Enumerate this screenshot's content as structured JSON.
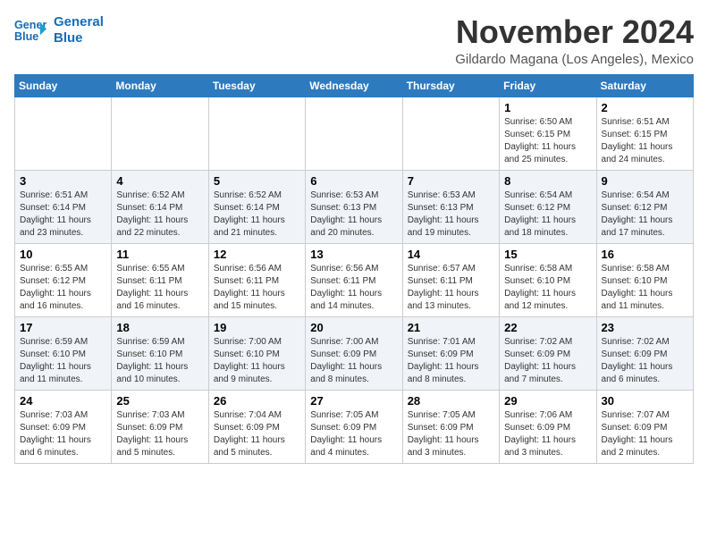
{
  "header": {
    "logo_line1": "General",
    "logo_line2": "Blue",
    "month_title": "November 2024",
    "subtitle": "Gildardo Magana (Los Angeles), Mexico"
  },
  "days_of_week": [
    "Sunday",
    "Monday",
    "Tuesday",
    "Wednesday",
    "Thursday",
    "Friday",
    "Saturday"
  ],
  "weeks": [
    [
      {
        "day": "",
        "info": ""
      },
      {
        "day": "",
        "info": ""
      },
      {
        "day": "",
        "info": ""
      },
      {
        "day": "",
        "info": ""
      },
      {
        "day": "",
        "info": ""
      },
      {
        "day": "1",
        "info": "Sunrise: 6:50 AM\nSunset: 6:15 PM\nDaylight: 11 hours\nand 25 minutes."
      },
      {
        "day": "2",
        "info": "Sunrise: 6:51 AM\nSunset: 6:15 PM\nDaylight: 11 hours\nand 24 minutes."
      }
    ],
    [
      {
        "day": "3",
        "info": "Sunrise: 6:51 AM\nSunset: 6:14 PM\nDaylight: 11 hours\nand 23 minutes."
      },
      {
        "day": "4",
        "info": "Sunrise: 6:52 AM\nSunset: 6:14 PM\nDaylight: 11 hours\nand 22 minutes."
      },
      {
        "day": "5",
        "info": "Sunrise: 6:52 AM\nSunset: 6:14 PM\nDaylight: 11 hours\nand 21 minutes."
      },
      {
        "day": "6",
        "info": "Sunrise: 6:53 AM\nSunset: 6:13 PM\nDaylight: 11 hours\nand 20 minutes."
      },
      {
        "day": "7",
        "info": "Sunrise: 6:53 AM\nSunset: 6:13 PM\nDaylight: 11 hours\nand 19 minutes."
      },
      {
        "day": "8",
        "info": "Sunrise: 6:54 AM\nSunset: 6:12 PM\nDaylight: 11 hours\nand 18 minutes."
      },
      {
        "day": "9",
        "info": "Sunrise: 6:54 AM\nSunset: 6:12 PM\nDaylight: 11 hours\nand 17 minutes."
      }
    ],
    [
      {
        "day": "10",
        "info": "Sunrise: 6:55 AM\nSunset: 6:12 PM\nDaylight: 11 hours\nand 16 minutes."
      },
      {
        "day": "11",
        "info": "Sunrise: 6:55 AM\nSunset: 6:11 PM\nDaylight: 11 hours\nand 16 minutes."
      },
      {
        "day": "12",
        "info": "Sunrise: 6:56 AM\nSunset: 6:11 PM\nDaylight: 11 hours\nand 15 minutes."
      },
      {
        "day": "13",
        "info": "Sunrise: 6:56 AM\nSunset: 6:11 PM\nDaylight: 11 hours\nand 14 minutes."
      },
      {
        "day": "14",
        "info": "Sunrise: 6:57 AM\nSunset: 6:11 PM\nDaylight: 11 hours\nand 13 minutes."
      },
      {
        "day": "15",
        "info": "Sunrise: 6:58 AM\nSunset: 6:10 PM\nDaylight: 11 hours\nand 12 minutes."
      },
      {
        "day": "16",
        "info": "Sunrise: 6:58 AM\nSunset: 6:10 PM\nDaylight: 11 hours\nand 11 minutes."
      }
    ],
    [
      {
        "day": "17",
        "info": "Sunrise: 6:59 AM\nSunset: 6:10 PM\nDaylight: 11 hours\nand 11 minutes."
      },
      {
        "day": "18",
        "info": "Sunrise: 6:59 AM\nSunset: 6:10 PM\nDaylight: 11 hours\nand 10 minutes."
      },
      {
        "day": "19",
        "info": "Sunrise: 7:00 AM\nSunset: 6:10 PM\nDaylight: 11 hours\nand 9 minutes."
      },
      {
        "day": "20",
        "info": "Sunrise: 7:00 AM\nSunset: 6:09 PM\nDaylight: 11 hours\nand 8 minutes."
      },
      {
        "day": "21",
        "info": "Sunrise: 7:01 AM\nSunset: 6:09 PM\nDaylight: 11 hours\nand 8 minutes."
      },
      {
        "day": "22",
        "info": "Sunrise: 7:02 AM\nSunset: 6:09 PM\nDaylight: 11 hours\nand 7 minutes."
      },
      {
        "day": "23",
        "info": "Sunrise: 7:02 AM\nSunset: 6:09 PM\nDaylight: 11 hours\nand 6 minutes."
      }
    ],
    [
      {
        "day": "24",
        "info": "Sunrise: 7:03 AM\nSunset: 6:09 PM\nDaylight: 11 hours\nand 6 minutes."
      },
      {
        "day": "25",
        "info": "Sunrise: 7:03 AM\nSunset: 6:09 PM\nDaylight: 11 hours\nand 5 minutes."
      },
      {
        "day": "26",
        "info": "Sunrise: 7:04 AM\nSunset: 6:09 PM\nDaylight: 11 hours\nand 5 minutes."
      },
      {
        "day": "27",
        "info": "Sunrise: 7:05 AM\nSunset: 6:09 PM\nDaylight: 11 hours\nand 4 minutes."
      },
      {
        "day": "28",
        "info": "Sunrise: 7:05 AM\nSunset: 6:09 PM\nDaylight: 11 hours\nand 3 minutes."
      },
      {
        "day": "29",
        "info": "Sunrise: 7:06 AM\nSunset: 6:09 PM\nDaylight: 11 hours\nand 3 minutes."
      },
      {
        "day": "30",
        "info": "Sunrise: 7:07 AM\nSunset: 6:09 PM\nDaylight: 11 hours\nand 2 minutes."
      }
    ]
  ]
}
